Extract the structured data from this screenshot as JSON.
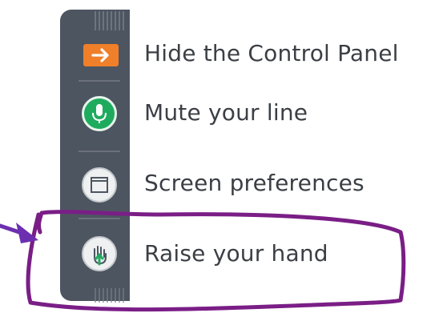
{
  "control_panel": {
    "items": [
      {
        "label": "Hide the Control Panel",
        "icon": "arrow-right-icon",
        "icon_color": "#f07f29"
      },
      {
        "label": "Mute your line",
        "icon": "microphone-icon",
        "icon_color": "#1fab5e"
      },
      {
        "label": "Screen preferences",
        "icon": "window-icon",
        "icon_color": "#4d5561"
      },
      {
        "label": "Raise your hand",
        "icon": "raise-hand-icon",
        "icon_color": "#1fab5e"
      }
    ]
  },
  "annotation": {
    "highlight_color": "#7a1e86",
    "arrow_color": "#6c2fb0",
    "highlighted_item": "Raise your hand"
  }
}
